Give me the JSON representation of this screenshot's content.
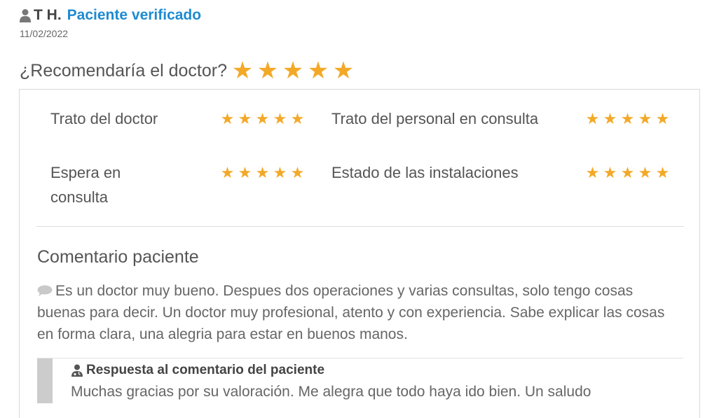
{
  "review": {
    "user_name": "T H.",
    "verified_label": "Paciente verificado",
    "date": "11/02/2022",
    "recommend_question": "¿Recomendaría el doctor?",
    "recommend_rating": 5,
    "star_color": "#f3a928",
    "ratings": [
      {
        "label": "Trato del doctor",
        "stars": 5
      },
      {
        "label": "Trato del personal en consulta",
        "stars": 5
      },
      {
        "label": "Espera en consulta",
        "stars": 5
      },
      {
        "label": "Estado de las instalaciones",
        "stars": 5
      }
    ],
    "comment_title": "Comentario paciente",
    "comment_text": "Es un doctor muy bueno. Despues dos operaciones y varias consultas, solo tengo cosas buenas para decir. Un doctor muy profesional, atento y con experiencia. Sabe explicar las cosas en forma clara, una alegria para estar en buenos manos.",
    "reply_title": "Respuesta al comentario del paciente",
    "reply_text": "Muchas gracias por su valoración. Me alegra que todo haya ido bien. Un saludo"
  }
}
